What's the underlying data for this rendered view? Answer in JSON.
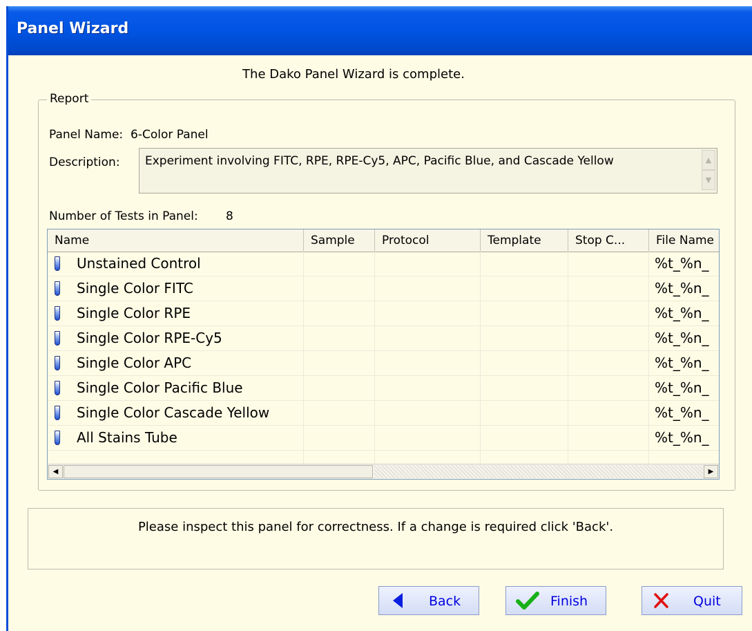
{
  "window": {
    "title": "Panel Wizard"
  },
  "banner": "The Dako Panel Wizard is complete.",
  "report": {
    "legend": "Report",
    "panel_name_label": "Panel Name:",
    "panel_name_value": "6-Color Panel",
    "description_label": "Description:",
    "description_value": "Experiment involving FITC, RPE, RPE-Cy5, APC, Pacific Blue, and Cascade Yellow",
    "tests_label": "Number of Tests in Panel:",
    "tests_count": "8"
  },
  "table": {
    "columns": [
      "Name",
      "Sample",
      "Protocol",
      "Template",
      "Stop C...",
      "File Name"
    ],
    "rows": [
      {
        "name": "Unstained Control",
        "file": "%t_%n_"
      },
      {
        "name": "Single Color FITC",
        "file": "%t_%n_"
      },
      {
        "name": "Single Color RPE",
        "file": "%t_%n_"
      },
      {
        "name": "Single Color RPE-Cy5",
        "file": "%t_%n_"
      },
      {
        "name": "Single Color APC",
        "file": "%t_%n_"
      },
      {
        "name": "Single Color Pacific Blue",
        "file": "%t_%n_"
      },
      {
        "name": "Single Color Cascade Yellow",
        "file": "%t_%n_"
      },
      {
        "name": "All Stains Tube",
        "file": "%t_%n_"
      }
    ]
  },
  "message": "Please inspect this panel for correctness. If a change is required click 'Back'.",
  "buttons": {
    "back": "Back",
    "finish": "Finish",
    "quit": "Quit"
  },
  "colors": {
    "titlebar": "#0054E3",
    "background": "#FFFCE6",
    "link_text": "#0000E0"
  }
}
